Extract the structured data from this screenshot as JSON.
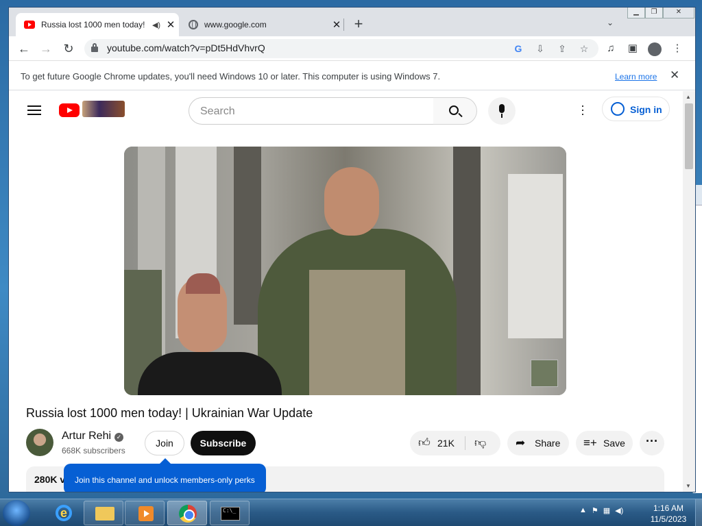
{
  "browser": {
    "tabs": [
      {
        "title": "Russia lost 1000 men today!",
        "active": true,
        "favicon": "youtube-icon"
      },
      {
        "title": "www.google.com",
        "active": false,
        "favicon": "globe-icon"
      }
    ],
    "url": "youtube.com/watch?v=pDt5HdVhvrQ",
    "infobar": {
      "message": "To get future Google Chrome updates, you'll need Windows 10 or later. This computer is using Windows 7.",
      "link": "Learn more"
    }
  },
  "youtube": {
    "search_placeholder": "Search",
    "signin_label": "Sign in",
    "video": {
      "title": "Russia lost 1000 men today! | Ukrainian War Update",
      "channel": "Artur Rehi",
      "subscribers": "668K subscribers",
      "join_label": "Join",
      "subscribe_label": "Subscribe",
      "likes": "21K",
      "share_label": "Share",
      "save_label": "Save",
      "views": "280K v",
      "tooltip": "Join this channel and unlock members-only perks"
    }
  },
  "taskbar": {
    "time": "1:16 AM",
    "date": "11/5/2023"
  },
  "colors": {
    "youtube_red": "#ff0000",
    "link_blue": "#065fd4",
    "chrome_blue": "#1a73e8"
  }
}
